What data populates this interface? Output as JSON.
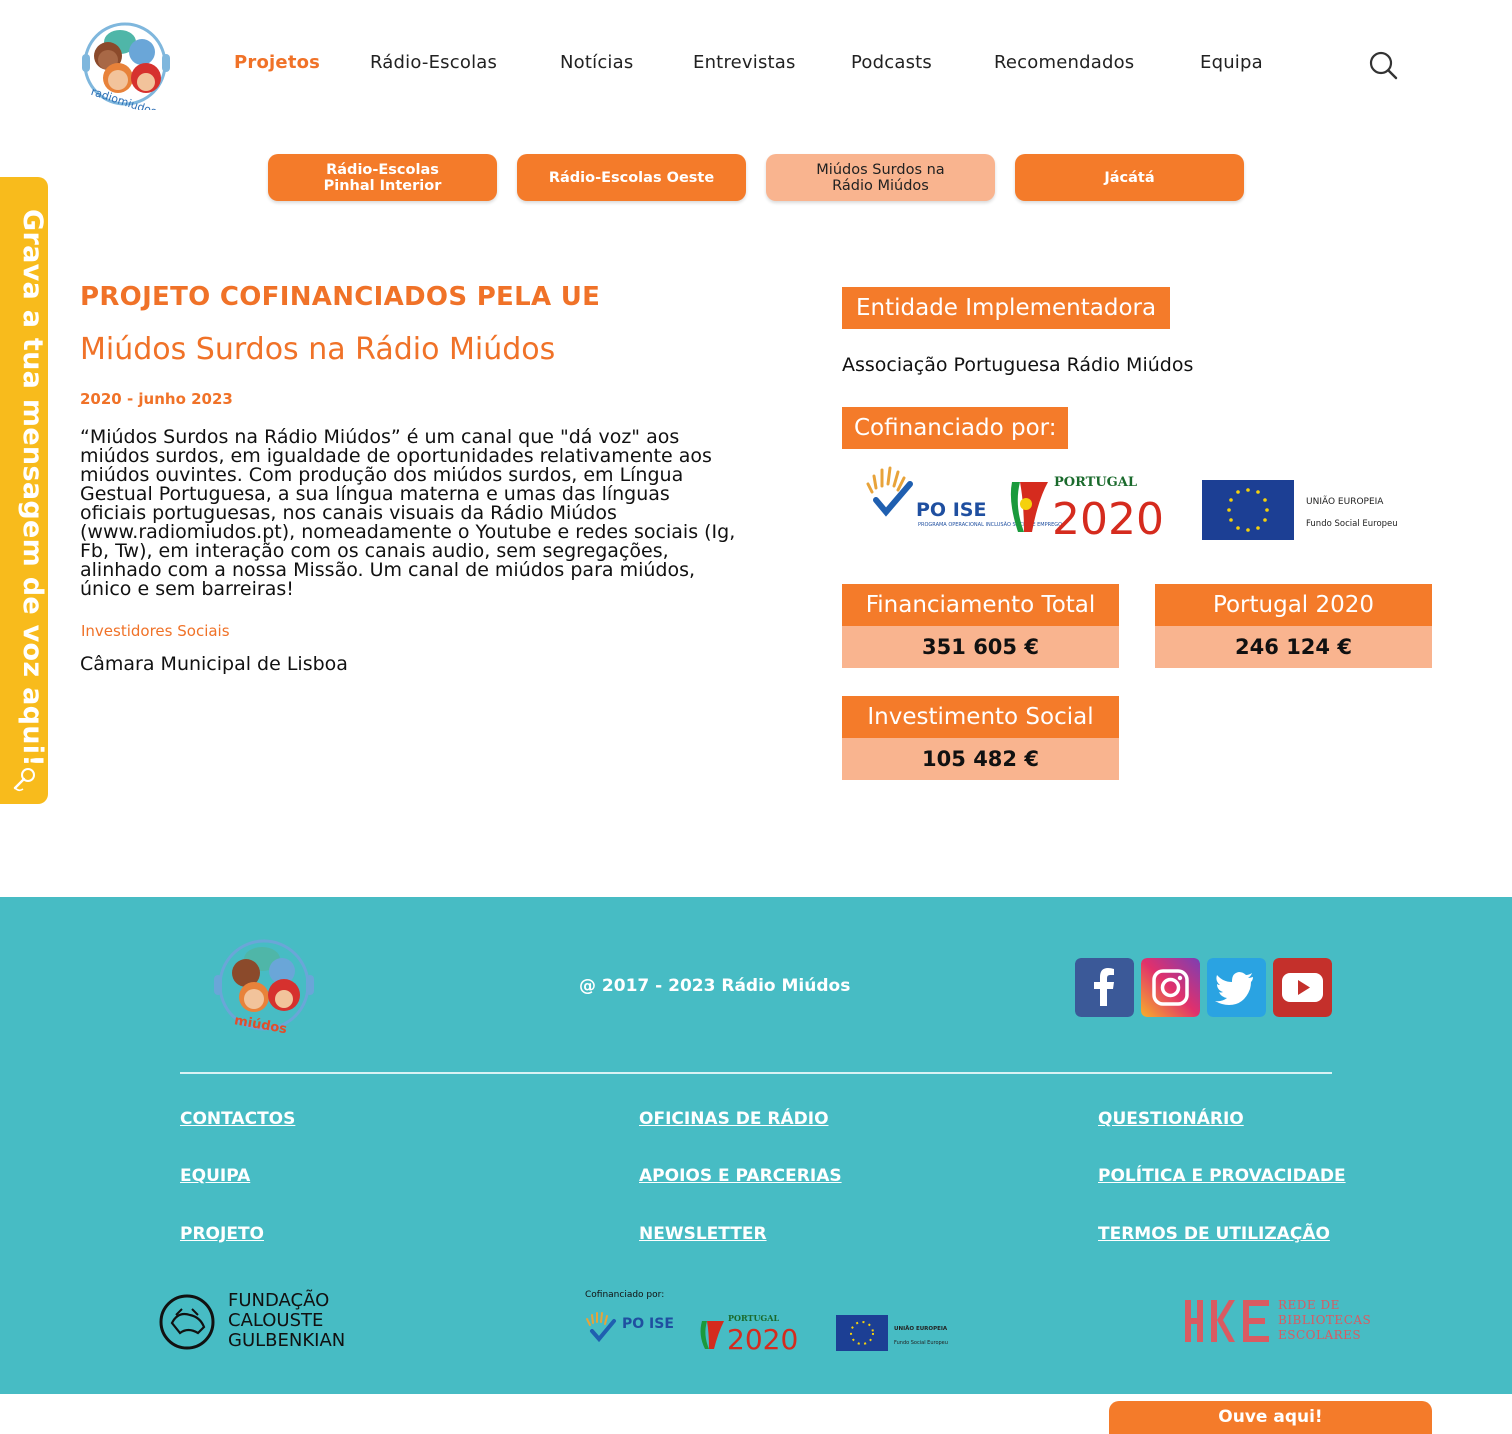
{
  "header": {
    "nav": [
      {
        "label": "Projetos",
        "active": true
      },
      {
        "label": "Rádio-Escolas"
      },
      {
        "label": "Notícias"
      },
      {
        "label": "Entrevistas"
      },
      {
        "label": "Podcasts"
      },
      {
        "label": "Recomendados"
      },
      {
        "label": "Equipa"
      }
    ],
    "logo_text": "radiomiudos.pt"
  },
  "subtabs": [
    {
      "label": "Rádio-Escolas Pinhal Interior"
    },
    {
      "label": "Rádio-Escolas Oeste"
    },
    {
      "label": "Miúdos Surdos na Rádio Miúdos",
      "current": true
    },
    {
      "label": "Jácátá"
    }
  ],
  "sidetab": {
    "label": "Grava a tua mensagem de voz aqui!"
  },
  "project": {
    "heading": "PROJETO COFINANCIADOS PELA UE",
    "title": "Miúdos Surdos na Rádio Miúdos",
    "dates": "2020 - junho 2023",
    "description": "“Miúdos Surdos na Rádio Miúdos” é um canal que \"dá voz\" aos miúdos surdos, em igualdade de oportunidades relativamente aos miúdos ouvintes. Com produção dos miúdos surdos, em Língua Gestual Portuguesa, a sua língua materna e umas das línguas oficiais portuguesas, nos canais visuais da Rádio Miúdos (www.radiomiudos.pt), nomeadamente o Youtube e redes sociais (Ig, Fb, Tw), em interação com os canais audio, sem segregações, alinhado com a nossa Missão. Um canal de miúdos para miúdos, único e sem barreiras!",
    "investors_label": "Investidores Sociais",
    "investors_value": "Câmara Municipal de Lisboa"
  },
  "side": {
    "entity_label": "Entidade Implementadora",
    "entity_value": "Associação Portuguesa Rádio Miúdos",
    "cofin_label": "Cofinanciado por:",
    "logos": {
      "poise": "PO ISE",
      "poise_sub": "PROGRAMA OPERACIONAL INCLUSÃO SOCIAL E EMPREGO",
      "pt_small": "PORTUGAL",
      "pt_big": "2020",
      "eu_title": "UNIÃO EUROPEIA",
      "eu_sub": "Fundo Social Europeu"
    },
    "cards": [
      {
        "title": "Financiamento Total",
        "value": "351 605 €"
      },
      {
        "title": "Portugal 2020",
        "value": "246 124 €"
      },
      {
        "title": "Investimento Social",
        "value": "105 482 €"
      }
    ]
  },
  "footer": {
    "logo_text": "miúdos",
    "copyright": "@ 2017 - 2023 Rádio Miúdos",
    "social": [
      "facebook-icon",
      "instagram-icon",
      "twitter-icon",
      "youtube-icon"
    ],
    "links": [
      [
        "CONTACTOS",
        "EQUIPA",
        "PROJETO"
      ],
      [
        "OFICINAS DE RÁDIO",
        "APOIOS E PARCERIAS",
        "NEWSLETTER"
      ],
      [
        "QUESTIONÁRIO",
        "POLÍTICA E PROVACIDADE",
        "TERMOS DE UTILIZAÇÃO"
      ]
    ],
    "gulbenkian": [
      "FUNDAÇÃO",
      "CALOUSTE",
      "GULBENKIAN"
    ],
    "cofin_small": "Cofinanciado por:",
    "rbe": [
      "REDE DE",
      "BIBLIOTECAS",
      "ESCOLARES"
    ]
  },
  "ouve": {
    "label": "Ouve aqui!"
  },
  "colors": {
    "orange": "#f47b2a",
    "peach": "#f9b48f",
    "teal": "#47bcc4",
    "yellow": "#f8bb1c"
  }
}
